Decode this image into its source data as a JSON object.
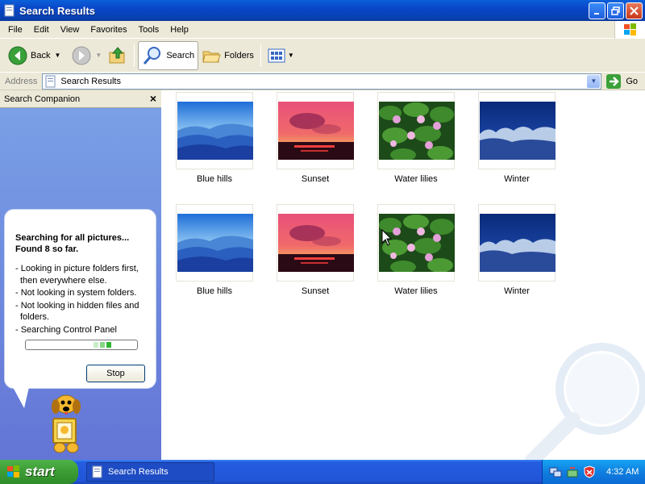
{
  "window": {
    "title": "Search Results"
  },
  "menu": [
    "File",
    "Edit",
    "View",
    "Favorites",
    "Tools",
    "Help"
  ],
  "toolbar": {
    "back_label": "Back",
    "search_label": "Search",
    "folders_label": "Folders"
  },
  "address": {
    "label": "Address",
    "value": "Search Results",
    "go_label": "Go"
  },
  "companion": {
    "title": "Search Companion",
    "heading_line1": "Searching for all pictures...",
    "heading_line2": "Found 8 so far.",
    "status_lines": [
      "- Looking in picture folders first, then everywhere else.",
      "- Not looking in system folders.",
      "- Not looking in hidden files and folders.",
      "- Searching Control Panel"
    ],
    "stop_label": "Stop"
  },
  "results": [
    {
      "name": "Blue hills",
      "thumb": "blue-hills"
    },
    {
      "name": "Sunset",
      "thumb": "sunset"
    },
    {
      "name": "Water lilies",
      "thumb": "water-lilies"
    },
    {
      "name": "Winter",
      "thumb": "winter"
    },
    {
      "name": "Blue hills",
      "thumb": "blue-hills"
    },
    {
      "name": "Sunset",
      "thumb": "sunset"
    },
    {
      "name": "Water lilies",
      "thumb": "water-lilies"
    },
    {
      "name": "Winter",
      "thumb": "winter"
    }
  ],
  "taskbar": {
    "start_label": "start",
    "task_label": "Search Results",
    "clock": "4:32 AM"
  }
}
